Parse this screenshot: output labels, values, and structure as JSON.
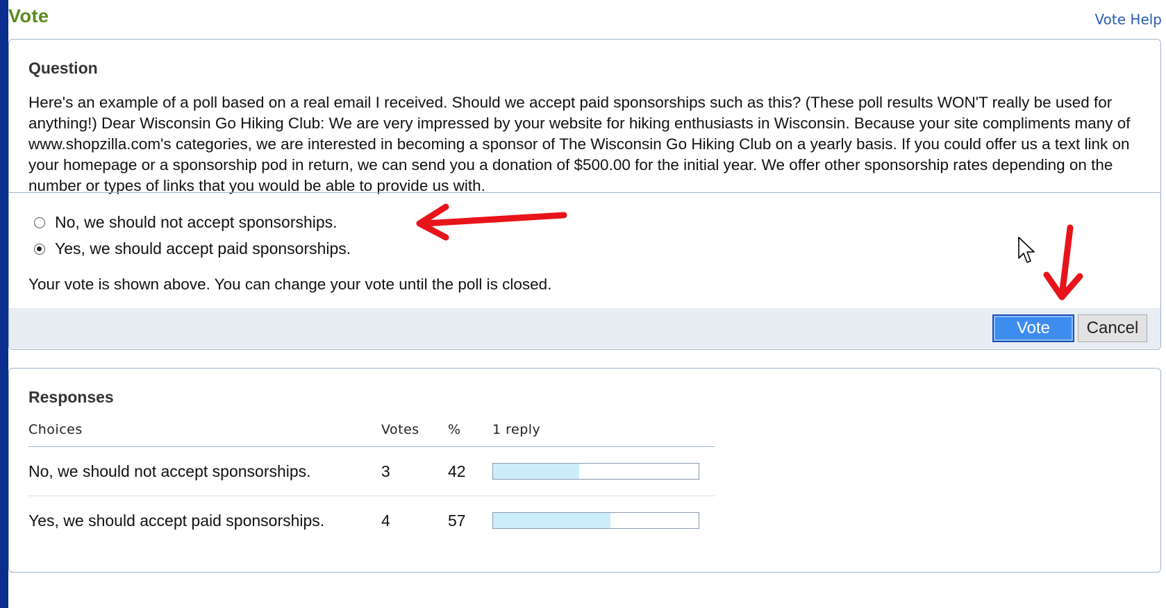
{
  "page": {
    "title": "Vote",
    "help_link": "Vote Help"
  },
  "question": {
    "heading": "Question",
    "text": "Here's an example of a poll based on a real email I received. Should we accept paid sponsorships such as this? (These poll results WON'T really be used for anything!) Dear Wisconsin Go Hiking Club: We are very impressed by your website for hiking enthusiasts in Wisconsin. Because your site compliments many of www.shopzilla.com's categories, we are interested in becoming a sponsor of The Wisconsin Go Hiking Club on a yearly basis. If you could offer us a text link on your homepage or a sponsorship pod in return, we can send you a donation of $500.00 for the initial year. We offer other sponsorship rates depending on the number or types of links that you would be able to provide us with.",
    "options": [
      {
        "label": "No, we should not accept sponsorships.",
        "selected": false
      },
      {
        "label": "Yes, we should accept paid sponsorships.",
        "selected": true
      }
    ],
    "status": "Your vote is shown above. You can change your vote until the poll is closed.",
    "vote_button": "Vote",
    "cancel_button": "Cancel"
  },
  "responses": {
    "heading": "Responses",
    "columns": {
      "choices": "Choices",
      "votes": "Votes",
      "percent": "%",
      "replies": "1 reply"
    },
    "rows": [
      {
        "choice": "No, we should not accept sponsorships.",
        "votes": "3",
        "percent": "42",
        "fill": 0.42
      },
      {
        "choice": "Yes, we should accept paid sponsorships.",
        "votes": "4",
        "percent": "57",
        "fill": 0.57
      }
    ]
  },
  "colors": {
    "background": "#0a2f8f",
    "title": "#5a8a1e",
    "link": "#2a5db0",
    "vote_button": "#3f8cf0",
    "bar_fill": "#cceefc",
    "annotation_arrow": "#e8141b"
  },
  "icons": {
    "cursor": "mouse-pointer-icon",
    "arrows": "red-annotation-arrow-icon"
  }
}
